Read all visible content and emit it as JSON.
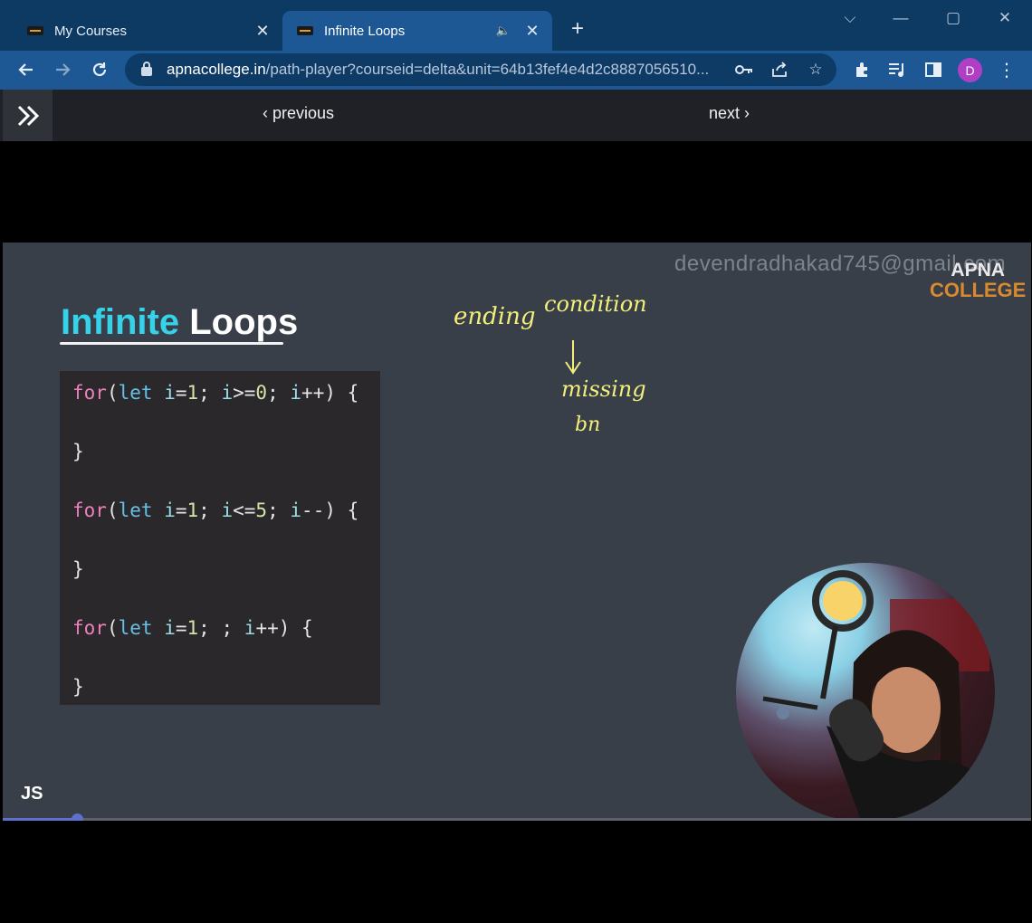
{
  "browser": {
    "tabs": [
      {
        "title": "My Courses",
        "active": false
      },
      {
        "title": "Infinite Loops",
        "active": true
      }
    ],
    "url_host": "apnacollege.in",
    "url_path": "/path-player?courseid=delta&unit=64b13fef4e4d2c8887056510...",
    "profile_initial": "D",
    "colors": {
      "tabbar": "#0d3a63",
      "toolbar": "#1d5894",
      "avatar": "#b03fc6"
    }
  },
  "nav": {
    "previous_label": "previous",
    "next_label": "next"
  },
  "video": {
    "watermark": "devendradhakad745@gmail.com",
    "brand_top": "APNA",
    "brand_bottom": "COLLEGE",
    "slide_title_part1": "Infinite",
    "slide_title_part2": "Loops",
    "code_lines": [
      "for(let i=1; i>=0; i++) {",
      "",
      "}",
      "",
      "for(let i=1; i<=5; i--) {",
      "",
      "}",
      "",
      "for(let i=1; ; i++) {",
      "",
      "}"
    ],
    "annotations": [
      "ending",
      "condition",
      "missing",
      "bn"
    ],
    "corner_label": "JS",
    "progress_fraction": 0.072
  },
  "icons": [
    "back-icon",
    "forward-icon",
    "reload-icon",
    "lock-icon",
    "key-icon",
    "share-icon",
    "star-icon",
    "extensions-icon",
    "media-icon",
    "sidepanel-icon",
    "menu-icon",
    "expand-icon",
    "speaker-icon"
  ]
}
